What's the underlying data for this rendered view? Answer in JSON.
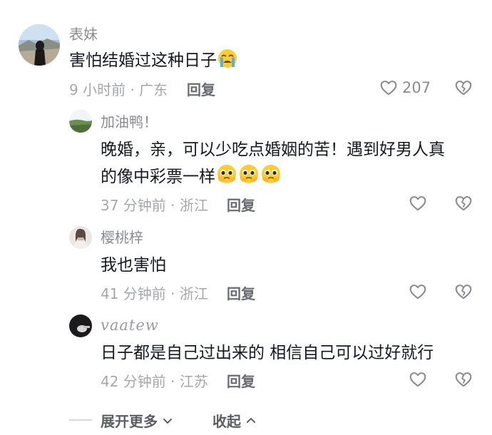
{
  "comments": [
    {
      "user": "表妹",
      "text": "害怕结婚过这种日子",
      "emoji_icon": "loudly-crying-face-icon",
      "meta": "9 小时前 · 广东",
      "reply_label": "回复",
      "likes": "207"
    }
  ],
  "replies": [
    {
      "user": "加油鸭！",
      "text_line1": "晚婚，亲，可以少吃点婚姻的苦！遇到好男人真",
      "text_line2": "的像中彩票一样",
      "emoji_icon": "pleading-face-icon",
      "meta": "37 分钟前 · 浙江",
      "reply_label": "回复"
    },
    {
      "user": "樱桃梓",
      "text": "我也害怕",
      "meta": "41 分钟前 · 浙江",
      "reply_label": "回复"
    },
    {
      "user": "vaatew",
      "text": "日子都是自己过出来的  相信自己可以过好就行",
      "meta": "42 分钟前 · 江苏",
      "reply_label": "回复"
    }
  ],
  "footer": {
    "expand_label": "展开更多",
    "collapse_label": "收起"
  },
  "colors": {
    "text": "#161823",
    "secondary": "#8a8b91",
    "meta": "#a6a7ad"
  }
}
